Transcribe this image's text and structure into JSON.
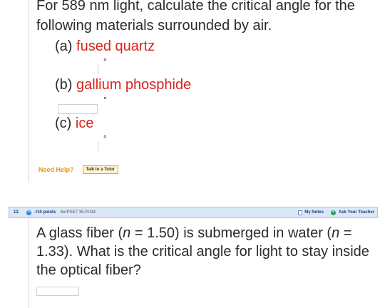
{
  "question11": {
    "text": "For 589 nm light, calculate the critical angle for the following materials surrounded by air.",
    "parts": [
      {
        "label": "(a)",
        "material": "fused quartz",
        "unit": "°"
      },
      {
        "label": "(b)",
        "material": "gallium phosphide",
        "unit": "°"
      },
      {
        "label": "(c)",
        "material": "ice",
        "unit": "°"
      }
    ],
    "need_help": "Need Help?",
    "tutor_button": "Talk to a Tutor"
  },
  "question12": {
    "number": "12.",
    "points": "-/10 points",
    "source": "SerPSE7 35.P.034.",
    "my_notes": "My Notes",
    "ask_teacher": "Ask Your Teacher",
    "text_parts": [
      "A glass fiber (",
      "n",
      " = 1.50) is submerged in water (",
      "n",
      " = 1.33). What is the critical angle for light to stay inside the optical fiber?"
    ]
  }
}
